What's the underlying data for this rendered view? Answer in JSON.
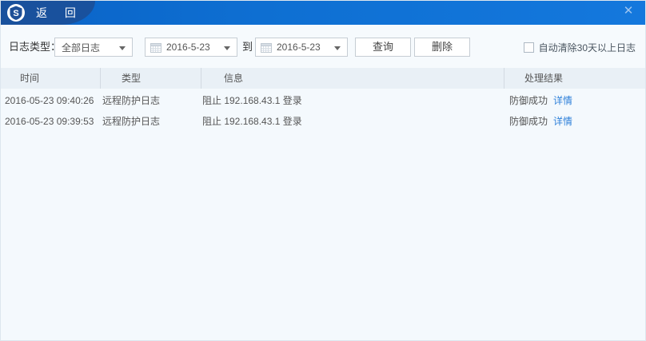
{
  "titlebar": {
    "title": "返 回",
    "logo_letter": "S",
    "close_glyph": "✕"
  },
  "filters": {
    "type_label": "日志类型：",
    "type_value": "全部日志",
    "date_from": "2016-5-23",
    "to_label": "到",
    "date_to": "2016-5-23",
    "query_button": "查询",
    "delete_button": "删除",
    "autoclean_label": "自动清除30天以上日志",
    "autoclean_checked": false
  },
  "table": {
    "columns": [
      "时间",
      "类型",
      "信息",
      "处理结果"
    ],
    "rows": [
      {
        "time": "2016-05-23 09:40:26",
        "type": "远程防护日志",
        "info": "阻止 192.168.43.1 登录",
        "result": "防御成功",
        "detail_link": "详情"
      },
      {
        "time": "2016-05-23 09:39:53",
        "type": "远程防护日志",
        "info": "阻止 192.168.43.1 登录",
        "result": "防御成功",
        "detail_link": "详情"
      }
    ]
  },
  "colors": {
    "accent": "#0e6fd2",
    "titlebar_dark": "#19519d",
    "link": "#2e80d9",
    "header_bg": "#e9f0f6",
    "content_bg": "#f4f9fd"
  }
}
